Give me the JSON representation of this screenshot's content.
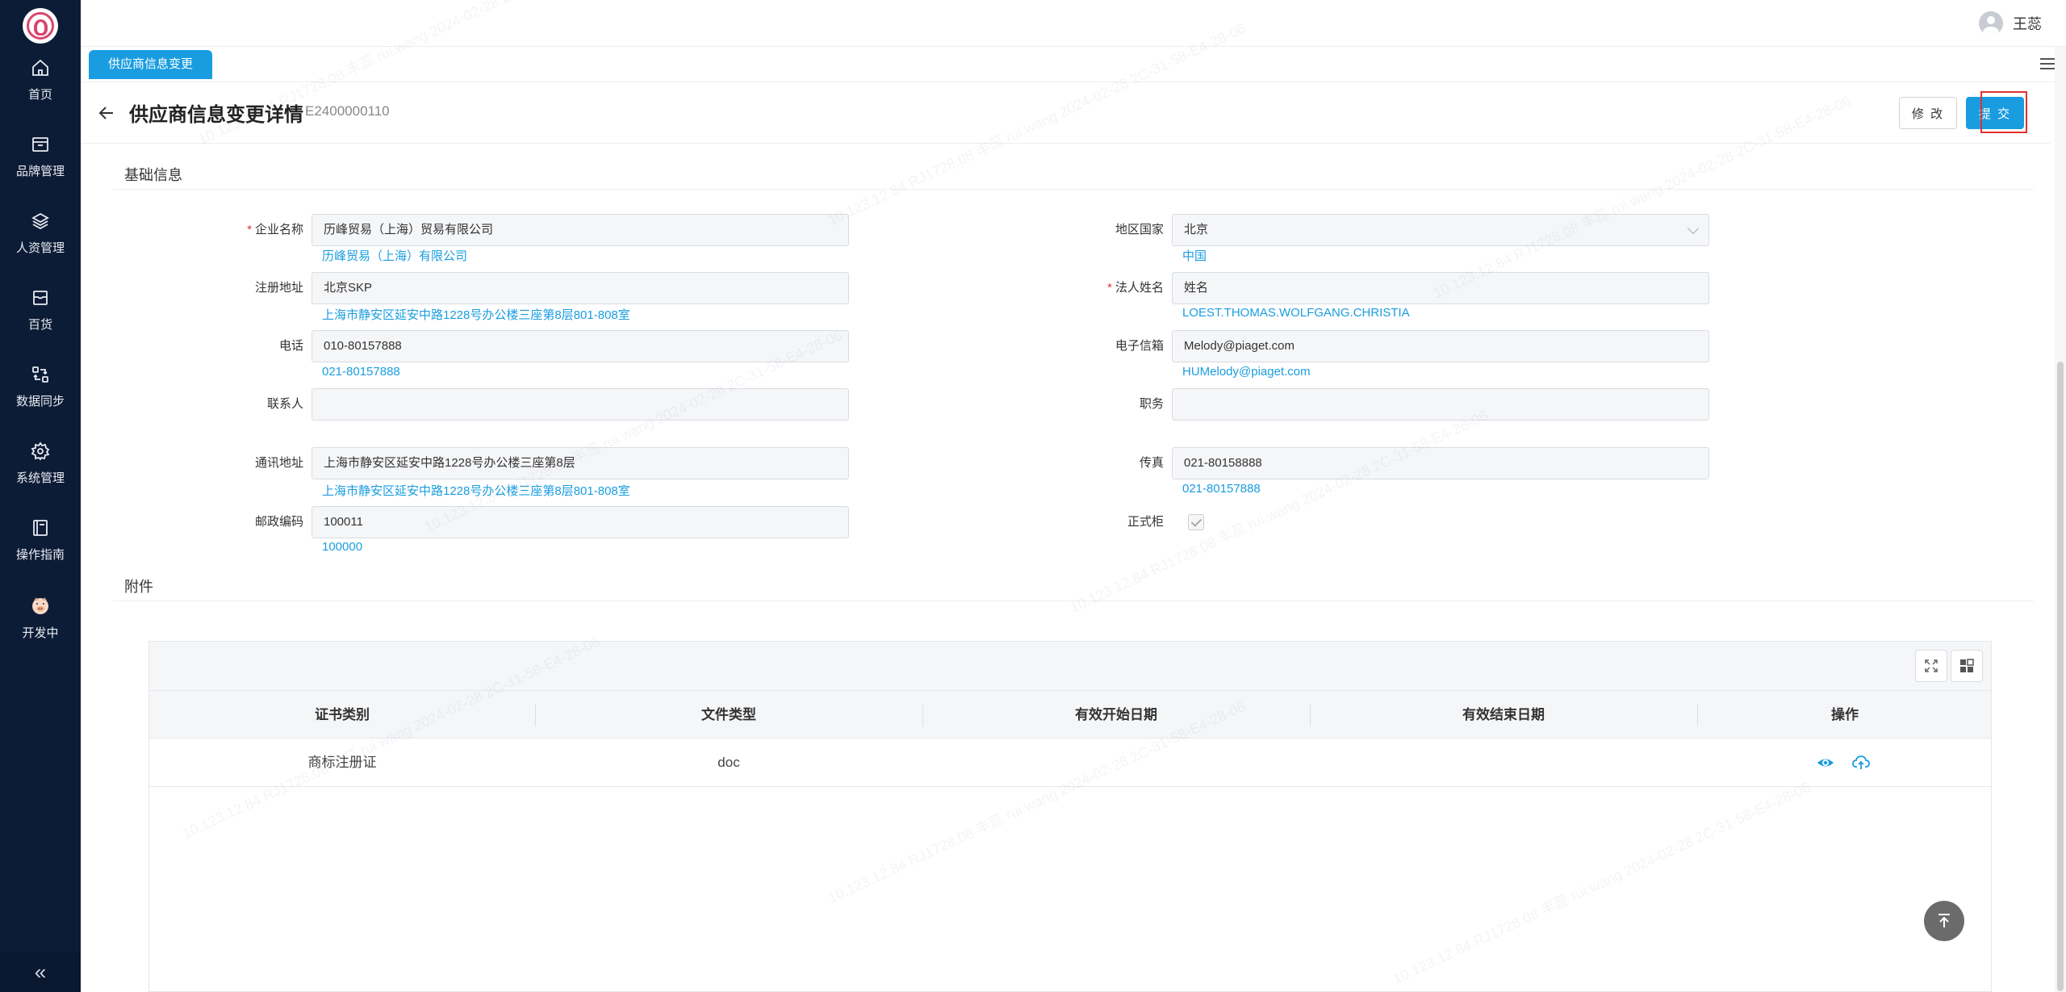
{
  "sidebar": {
    "items": [
      {
        "label": "首页",
        "icon": "home-icon"
      },
      {
        "label": "品牌管理",
        "icon": "brand-icon"
      },
      {
        "label": "人资管理",
        "icon": "layers-icon"
      },
      {
        "label": "百货",
        "icon": "store-icon"
      },
      {
        "label": "数据同步",
        "icon": "sync-icon"
      },
      {
        "label": "系统管理",
        "icon": "gear-icon"
      },
      {
        "label": "操作指南",
        "icon": "book-icon"
      },
      {
        "label": "开发中",
        "icon": "pig-icon"
      }
    ],
    "collapse_label": "«"
  },
  "header": {
    "user_name": "王蕊"
  },
  "tabs": [
    {
      "label": "供应商信息变更",
      "active": true
    }
  ],
  "page": {
    "title": "供应商信息变更详情",
    "code": "E2400000110",
    "edit_label": "修 改",
    "submit_label": "提 交"
  },
  "basic_section": {
    "title": "基础信息",
    "fields": {
      "company_name": {
        "label": "企业名称",
        "required": true,
        "value": "历峰贸易（上海）贸易有限公司",
        "hint": "历峰贸易（上海）有限公司"
      },
      "region": {
        "label": "地区国家",
        "value": "北京",
        "hint": "中国"
      },
      "reg_address": {
        "label": "注册地址",
        "value": "北京SKP",
        "hint": "上海市静安区延安中路1228号办公楼三座第8层801-808室"
      },
      "legal_name": {
        "label": "法人姓名",
        "required": true,
        "value": "姓名",
        "hint": "LOEST.THOMAS.WOLFGANG.CHRISTIA"
      },
      "phone": {
        "label": "电话",
        "value": "010-80157888",
        "hint": "021-80157888"
      },
      "email": {
        "label": "电子信箱",
        "value": "Melody@piaget.com",
        "hint": "HUMelody@piaget.com"
      },
      "contact": {
        "label": "联系人",
        "value": ""
      },
      "position": {
        "label": "职务",
        "value": ""
      },
      "mail_address": {
        "label": "通讯地址",
        "value": "上海市静安区延安中路1228号办公楼三座第8层",
        "hint": "上海市静安区延安中路1228号办公楼三座第8层801-808室"
      },
      "fax": {
        "label": "传真",
        "value": "021-80158888",
        "hint": "021-80157888"
      },
      "postcode": {
        "label": "邮政编码",
        "value": "100011",
        "hint": "100000"
      },
      "official": {
        "label": "正式柜",
        "checked": true
      }
    }
  },
  "attachments": {
    "title": "附件",
    "columns": [
      "证书类别",
      "文件类型",
      "有效开始日期",
      "有效结束日期",
      "操作"
    ],
    "rows": [
      {
        "category": "商标注册证",
        "file_type": "doc",
        "start_date": "",
        "end_date": ""
      }
    ]
  },
  "watermark": "10.123.12.84 RJ1728.08 丰蕊 rui.wang 2024-02-28 2C-31-58-E4-28-06",
  "colors": {
    "sidebar_bg": "#0d1c36",
    "accent": "#1a9de0",
    "required": "#e0322f",
    "highlight_border": "#e0322f"
  }
}
